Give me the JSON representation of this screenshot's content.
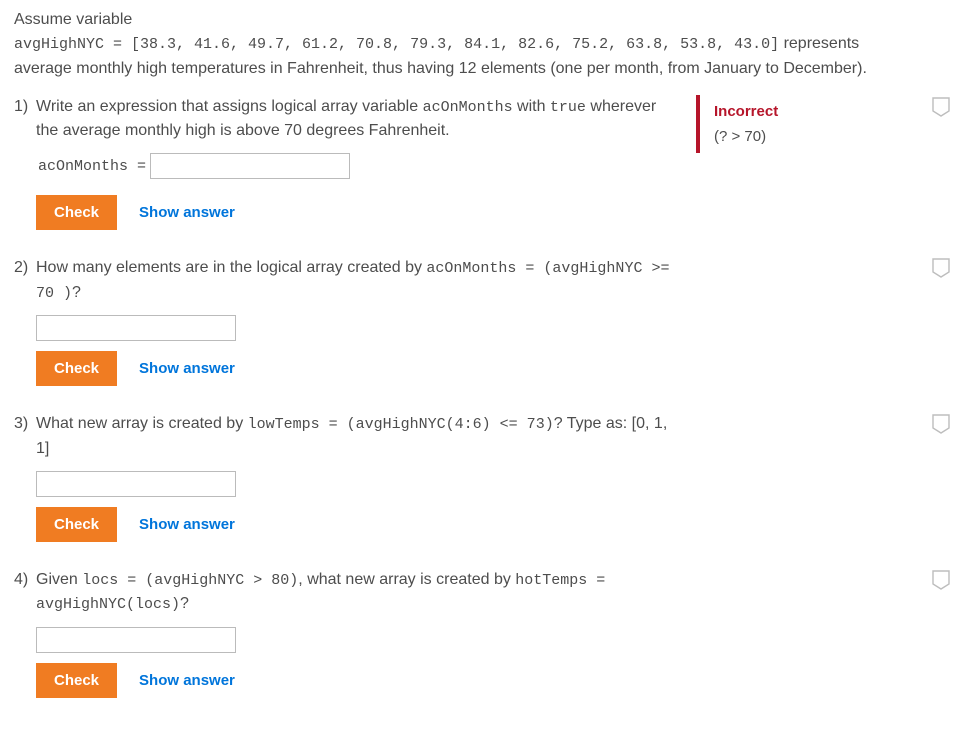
{
  "intro": {
    "line1a": "Assume variable",
    "code": "avgHighNYC = [38.3, 41.6, 49.7, 61.2, 70.8, 79.3, 84.1, 82.6, 75.2, 63.8, 53.8, 43.0]",
    "line1b": " represents",
    "line2": "average monthly high temperatures in Fahrenheit, thus having 12 elements (one per month, from January to December)."
  },
  "check_label": "Check",
  "show_answer_label": "Show answer",
  "q1": {
    "num": "1)",
    "text_a": "Write an expression that assigns logical array variable ",
    "code_a": "acOnMonths",
    "text_b": " with ",
    "code_b": "true",
    "text_c": " wherever the average monthly high is above 70 degrees Fahrenheit.",
    "prefill": "acOnMonths =",
    "feedback_title": "Incorrect",
    "feedback_hint": "(? > 70)"
  },
  "q2": {
    "num": "2)",
    "text_a": "How many elements are in the logical array created by ",
    "code_a": "acOnMonths = (avgHighNYC >= 70 )",
    "text_b": "?"
  },
  "q3": {
    "num": "3)",
    "text_a": "What new array is created by ",
    "code_a": "lowTemps = (avgHighNYC(4:6) <= 73)",
    "text_b": "? Type as: [0, 1, 1]"
  },
  "q4": {
    "num": "4)",
    "text_a": "Given ",
    "code_a": "locs = (avgHighNYC > 80)",
    "text_b": ", what new array is created by ",
    "code_b": "hotTemps = avgHighNYC(locs)",
    "text_c": "?"
  }
}
